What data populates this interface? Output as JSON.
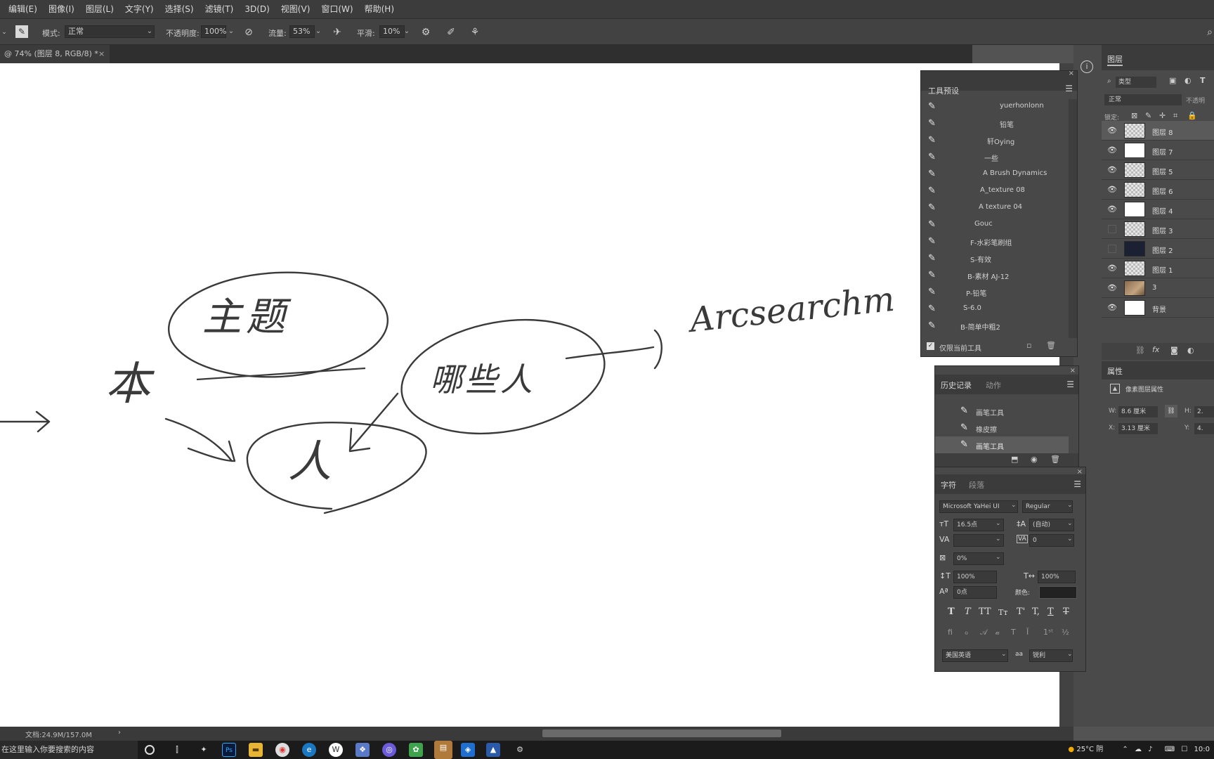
{
  "menu": [
    "编辑(E)",
    "图像(I)",
    "图层(L)",
    "文字(Y)",
    "选择(S)",
    "滤镜(T)",
    "3D(D)",
    "视图(V)",
    "窗口(W)",
    "帮助(H)"
  ],
  "options": {
    "mode_label": "模式:",
    "mode_value": "正常",
    "opacity_label": "不透明度:",
    "opacity_value": "100%",
    "flow_label": "流量:",
    "flow_value": "53%",
    "smoothing_label": "平滑:",
    "smoothing_value": "10%"
  },
  "document_tab": {
    "title": "@ 74% (图层 8, RGB/8) *",
    "close": "×"
  },
  "brush_panel": {
    "title": "工具预设",
    "items": [
      "yuerhonlonn",
      "铅笔",
      "轩Oying",
      "一些",
      "A Brush Dynamics",
      "A_texture 08",
      "A texture 04",
      "Gouc",
      "F-水彩笔刷组",
      "S-有效",
      "B-素材 AJ-12",
      "P-铅笔",
      "S-6.0",
      "B-简单中粗2"
    ],
    "footer_label": "仅限当前工具"
  },
  "history_panel": {
    "tabs": [
      "历史记录",
      "动作"
    ],
    "items": [
      "画笔工具",
      "橡皮擦",
      "画笔工具"
    ]
  },
  "character_panel": {
    "tabs": [
      "字符",
      "段落"
    ],
    "font_family": "Microsoft YaHei UI",
    "font_style": "Regular",
    "font_size": "16.5点",
    "leading": "(自动)",
    "kerning": "",
    "tracking": "0",
    "scale_percent": "0%",
    "vertical_scale": "100%",
    "horizontal_scale": "100%",
    "baseline_shift": "0点",
    "color_label": "颜色:",
    "language": "美国英语",
    "aa_label": "aa",
    "antialias": "锐利"
  },
  "layers_panel": {
    "tab": "图层",
    "search_placeholder": "类型",
    "blend_mode": "正常",
    "opacity_label": "不透明",
    "lock_label": "锁定:",
    "layers": [
      {
        "name": "图层 8",
        "visible": true,
        "thumb": "check",
        "selected": true
      },
      {
        "name": "图层 7",
        "visible": true,
        "thumb": "white",
        "selected": false
      },
      {
        "name": "图层 5",
        "visible": true,
        "thumb": "check",
        "selected": false
      },
      {
        "name": "图层 6",
        "visible": true,
        "thumb": "check",
        "selected": false
      },
      {
        "name": "图层 4",
        "visible": true,
        "thumb": "white",
        "selected": false
      },
      {
        "name": "图层 3",
        "visible": false,
        "thumb": "check",
        "selected": false
      },
      {
        "name": "图层 2",
        "visible": false,
        "thumb": "dark",
        "selected": false
      },
      {
        "name": "图层 1",
        "visible": true,
        "thumb": "check",
        "selected": false
      },
      {
        "name": "3",
        "visible": true,
        "thumb": "photo",
        "selected": false
      },
      {
        "name": "背景",
        "visible": true,
        "thumb": "white",
        "selected": false
      }
    ]
  },
  "properties_panel": {
    "tab": "属性",
    "subtitle": "像素图层属性",
    "w_value": "8.6 厘米",
    "h_value": "2.",
    "x_value": "3.13 厘米",
    "y_value": "4."
  },
  "status": {
    "doc_info": "文档:24.9M/157.0M"
  },
  "taskbar": {
    "search_text": "在这里输入你要搜索的内容",
    "weather": "25°C 阴",
    "clock": "10:0"
  },
  "canvas_text": {
    "word1": "主题",
    "word2": "本",
    "word3": "人",
    "word4": "哪些人",
    "scribble": "Arcsearchm"
  }
}
